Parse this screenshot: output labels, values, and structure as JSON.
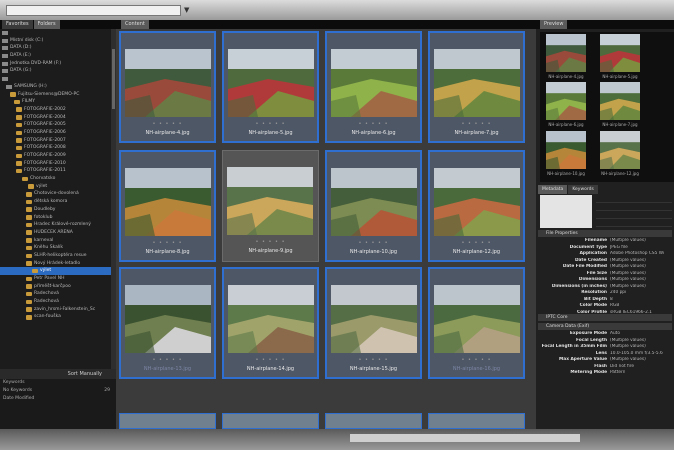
{
  "left_tabs": [
    "Favorites",
    "Folders"
  ],
  "content_tab": "Content",
  "right_tabs": [
    "Preview"
  ],
  "meta_tabs": [
    "Metadata",
    "Keywords"
  ],
  "tree": [
    {
      "label": "",
      "type": "drive"
    },
    {
      "label": "Místní disk (C:)",
      "type": "drive"
    },
    {
      "label": "DATA (D:)",
      "type": "drive"
    },
    {
      "label": "DATA (E:)",
      "type": "drive"
    },
    {
      "label": "Jednotka DVD-RAM (F:)",
      "type": "drive"
    },
    {
      "label": "DATA (G:)",
      "type": "drive"
    },
    {
      "label": "",
      "type": "drive"
    },
    {
      "label": "SAMSUNG (H:)",
      "type": "drive"
    },
    {
      "label": "Fujitsu-Siemens@DEMO-PC",
      "type": "folder"
    },
    {
      "label": "FILMY",
      "type": "folder"
    },
    {
      "label": "FOTOGRAFIE-2002",
      "type": "folder"
    },
    {
      "label": "FOTOGRAFIE-2004",
      "type": "folder"
    },
    {
      "label": "FOTOGRAFIE-2005",
      "type": "folder"
    },
    {
      "label": "FOTOGRAFIE-2006",
      "type": "folder"
    },
    {
      "label": "FOTOGRAFIE-2007",
      "type": "folder"
    },
    {
      "label": "FOTOGRAFIE-2008",
      "type": "folder"
    },
    {
      "label": "FOTOGRAFIE-2009",
      "type": "folder"
    },
    {
      "label": "FOTOGRAFIE-2010",
      "type": "folder"
    },
    {
      "label": "FOTOGRAFIE-2011",
      "type": "folder"
    },
    {
      "label": "Chorvatsko",
      "type": "folder"
    },
    {
      "label": "výlet",
      "type": "folder"
    },
    {
      "label": "Chotovice-dovolená",
      "type": "folder"
    },
    {
      "label": "dětská komora",
      "type": "folder"
    },
    {
      "label": "Doudleby",
      "type": "folder"
    },
    {
      "label": "fotoklub",
      "type": "folder"
    },
    {
      "label": "Hradec Králové-rozmlený",
      "type": "folder"
    },
    {
      "label": "HUDECEK ARENA",
      "type": "folder"
    },
    {
      "label": "karneval",
      "type": "folder"
    },
    {
      "label": "Kněhu Skalík",
      "type": "folder"
    },
    {
      "label": "SLHR-helikoptéra resue",
      "type": "folder"
    },
    {
      "label": "Nový Hrádek-letadlo",
      "type": "folder"
    },
    {
      "label": "výlet",
      "type": "folder",
      "selected": true
    },
    {
      "label": "Petr Pavel NH",
      "type": "folder"
    },
    {
      "label": "příměšť-karčpoo",
      "type": "folder"
    },
    {
      "label": "Radechová",
      "type": "folder"
    },
    {
      "label": "Radechová",
      "type": "folder"
    },
    {
      "label": "zavin_hrsmi-Falkenstein_Sc",
      "type": "folder"
    },
    {
      "label": "scan-fouška",
      "type": "folder"
    }
  ],
  "sort_label": "Sort Manually",
  "keywords": [
    {
      "label": "Keywords",
      "count": "",
      "dim": false
    },
    {
      "label": "No Keywords",
      "count": "29",
      "dim": false
    },
    {
      "label": "Date Modified",
      "count": "",
      "dim": false
    },
    {
      "label": "",
      "count": "",
      "dim": true
    }
  ],
  "thumbnails": [
    {
      "name": "NH-airplane-4.jpg",
      "selected": true,
      "dim": false
    },
    {
      "name": "NH-airplane-5.jpg",
      "selected": true,
      "dim": false
    },
    {
      "name": "NH-airplane-6.jpg",
      "selected": true,
      "dim": false
    },
    {
      "name": "NH-airplane-7.jpg",
      "selected": true,
      "dim": false
    },
    {
      "name": "NH-airplane-8.jpg",
      "selected": true,
      "dim": false
    },
    {
      "name": "NH-airplane-9.jpg",
      "selected": false,
      "dim": false
    },
    {
      "name": "NH-airplane-10.jpg",
      "selected": true,
      "dim": false
    },
    {
      "name": "NH-airplane-12.jpg",
      "selected": true,
      "dim": false
    },
    {
      "name": "NH-airplane-13.jpg",
      "selected": true,
      "dim": true
    },
    {
      "name": "NH-airplane-14.jpg",
      "selected": true,
      "dim": false
    },
    {
      "name": "NH-airplane-15.jpg",
      "selected": true,
      "dim": false
    },
    {
      "name": "NH-airplane-16.jpg",
      "selected": true,
      "dim": true
    }
  ],
  "preview_labels": [
    "NH-airplane-4.jpg",
    "NH-airplane-5.jpg",
    "NH-airplane-6.jpg",
    "NH-airplane-7.jpg",
    "NH-airplane-10.jpg",
    "NH-airplane-12.jpg"
  ],
  "sections": {
    "file": "File Properties",
    "iptc": "IPTC Core",
    "camera": "Camera Data (Exif)"
  },
  "file_props": [
    {
      "k": "Filename",
      "v": "(Multiple values)"
    },
    {
      "k": "Document Type",
      "v": "JPEG file"
    },
    {
      "k": "Application",
      "v": "Adobe Photoshop CS5 Wi"
    },
    {
      "k": "Date Created",
      "v": "(Multiple values)"
    },
    {
      "k": "Date File Modified",
      "v": "(Multiple values)"
    },
    {
      "k": "File Size",
      "v": "(Multiple values)"
    },
    {
      "k": "Dimensions",
      "v": "(Multiple values)"
    },
    {
      "k": "Dimensions (in inches)",
      "v": "(Multiple values)"
    },
    {
      "k": "Resolution",
      "v": "240 ppi"
    },
    {
      "k": "Bit Depth",
      "v": "8"
    },
    {
      "k": "Color Mode",
      "v": "RGB"
    },
    {
      "k": "Color Profile",
      "v": "sRGB IEC61966-2.1"
    }
  ],
  "camera_props": [
    {
      "k": "Exposure Mode",
      "v": "Auto"
    },
    {
      "k": "Focal Length",
      "v": "(Multiple values)"
    },
    {
      "k": "Focal Length in 35mm Film",
      "v": "(Multiple values)"
    },
    {
      "k": "Lens",
      "v": "10.0-105.0 mm f/3.5-5.6"
    },
    {
      "k": "Max Aperture Value",
      "v": "(Multiple values)"
    },
    {
      "k": "Flash",
      "v": "Did not fire"
    },
    {
      "k": "Metering Mode",
      "v": "Pattern"
    }
  ]
}
